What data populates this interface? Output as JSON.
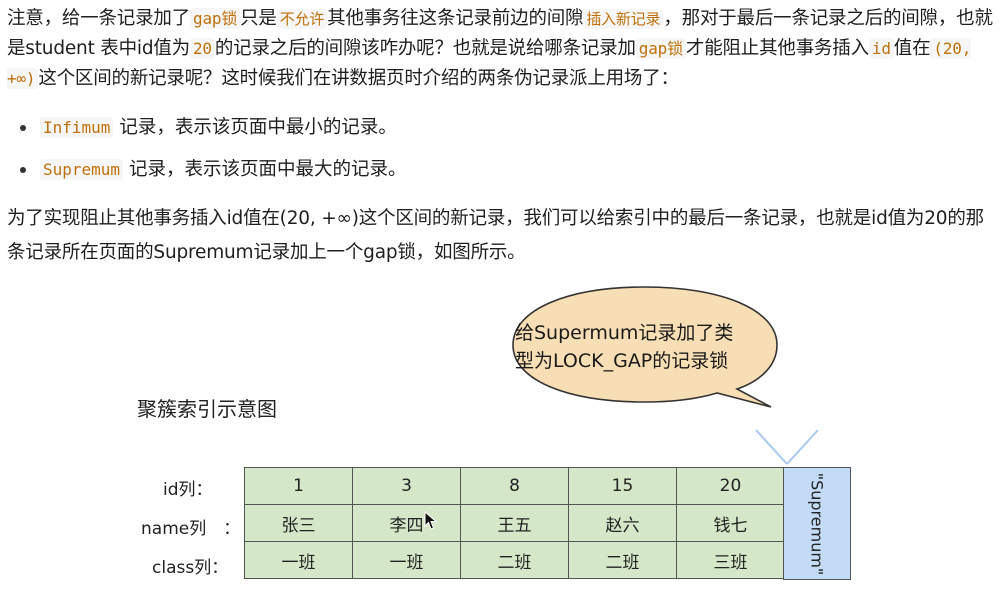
{
  "para1": {
    "s1": "注意，给一条记录加了",
    "c1": "gap锁",
    "s2": "只是",
    "h1": "不允许",
    "s3": "其他事务往这条记录前边的间隙",
    "h2": "插入新记录",
    "s4": "，那对于最后一条记录之后的间隙，也就是student 表中id值为",
    "c2": "20",
    "s5": "的记录之后的间隙该咋办呢？也就是说给哪条记录加",
    "c3": "gap锁",
    "s6": "才能阻止其他事务插入",
    "c4": "id",
    "s7": "值在",
    "c5": "(20, +∞)",
    "s8": "这个区间的新记录呢？这时候我们在讲数据页时介绍的两条伪记录派上用场了："
  },
  "bullets": [
    {
      "code": "Infimum",
      "text": "记录，表示该页面中最小的记录。"
    },
    {
      "code": "Supremum",
      "text": "记录，表示该页面中最大的记录。"
    }
  ],
  "para2": "为了实现阻止其他事务插入id值在(20, +∞)这个区间的新记录，我们可以给索引中的最后一条记录，也就是id值为20的那条记录所在页面的Supremum记录加上一个gap锁，如图所示。",
  "bubble": {
    "line1": "给Supermum记录加了类",
    "line2": "型为LOCK_GAP的记录锁"
  },
  "diagram": {
    "title": "聚簇索引示意图",
    "labels": {
      "id": "id列：",
      "name": "name列　：",
      "class": "class列："
    },
    "ids": [
      "1",
      "3",
      "8",
      "15",
      "20"
    ],
    "names": [
      "张三",
      "李四",
      "王五",
      "赵六",
      "钱七"
    ],
    "classes": [
      "一班",
      "一班",
      "二班",
      "二班",
      "三班"
    ],
    "supremum": "\"Supremum\""
  },
  "colors": {
    "record_fill": "#d5e7c9",
    "supremum_fill": "#c4dbf7",
    "bubble_fill": "#f7deb5",
    "code_text": "#c0700b"
  }
}
